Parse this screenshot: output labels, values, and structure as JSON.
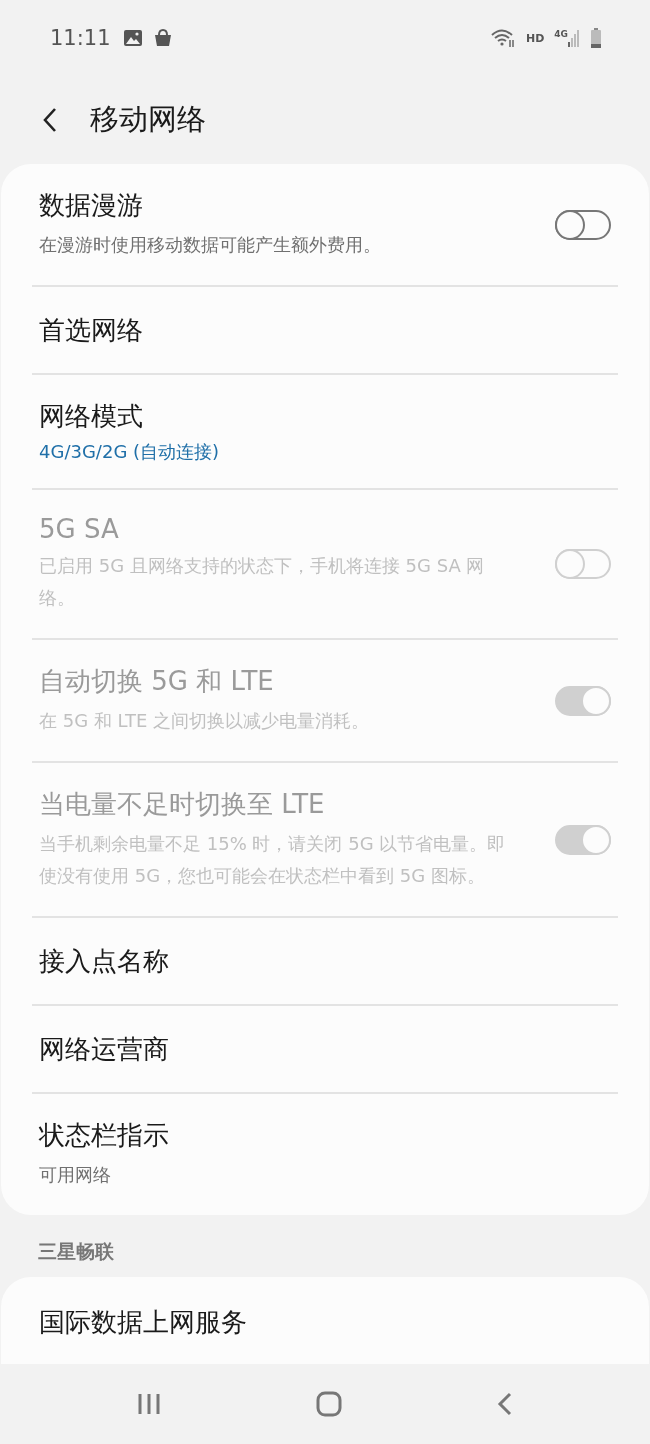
{
  "status_bar": {
    "time": "11:11",
    "hd": "HD",
    "network": "4G"
  },
  "header": {
    "title": "移动网络"
  },
  "settings": [
    {
      "kind": "toggle",
      "title": "数据漫游",
      "subtitle": "在漫游时使用移动数据可能产生额外费用。",
      "on": false,
      "disabled": false
    },
    {
      "kind": "link",
      "title": "首选网络",
      "disabled": false
    },
    {
      "kind": "link",
      "title": "网络模式",
      "value": "4G/3G/2G (自动连接)",
      "disabled": false
    },
    {
      "kind": "toggle",
      "title": "5G SA",
      "subtitle": "已启用 5G 且网络支持的状态下，手机将连接 5G SA 网络。",
      "on": false,
      "disabled": true
    },
    {
      "kind": "toggle",
      "title": "自动切换 5G 和 LTE",
      "subtitle": "在 5G 和 LTE 之间切换以减少电量消耗。",
      "on": true,
      "disabled": true
    },
    {
      "kind": "toggle",
      "title": "当电量不足时切换至 LTE",
      "subtitle": "当手机剩余电量不足 15% 时，请关闭 5G 以节省电量。即使没有使用 5G，您也可能会在状态栏中看到 5G 图标。",
      "on": true,
      "disabled": true
    },
    {
      "kind": "link",
      "title": "接入点名称",
      "disabled": false
    },
    {
      "kind": "link",
      "title": "网络运营商",
      "disabled": false
    },
    {
      "kind": "link",
      "title": "状态栏指示",
      "subtitle": "可用网络",
      "disabled": false
    }
  ],
  "section": {
    "title": "三星畅联",
    "items": [
      {
        "title": "国际数据上网服务"
      }
    ]
  }
}
